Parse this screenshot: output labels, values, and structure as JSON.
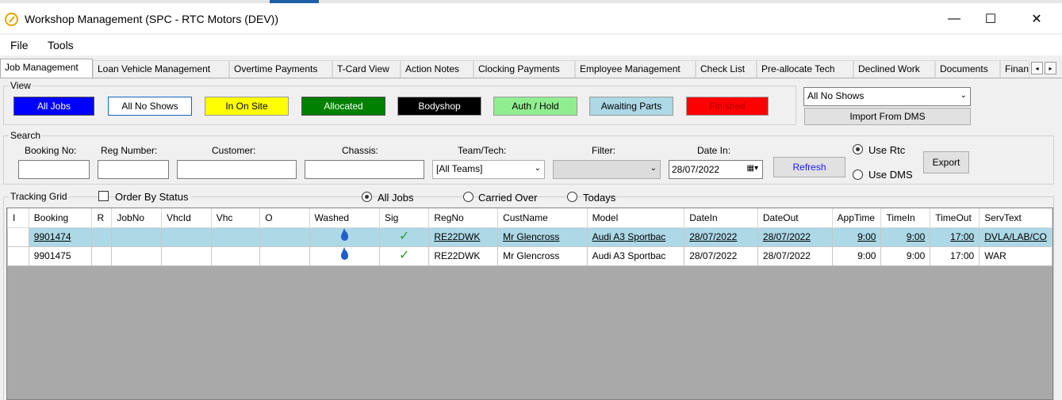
{
  "window": {
    "title": "Workshop Management  (SPC - RTC Motors (DEV))",
    "minimize": "—",
    "maximize": "☐",
    "close": "✕"
  },
  "menu": [
    "File",
    "Tools"
  ],
  "tabs": [
    "Job Management",
    "Loan Vehicle Management",
    "Overtime Payments",
    "T-Card View",
    "Action Notes",
    "Clocking Payments",
    "Employee Management",
    "Check List",
    "Pre-allocate Tech",
    "Declined Work",
    "Documents",
    "Finan"
  ],
  "tab_scroll": {
    "left": "◂",
    "right": "▸"
  },
  "view": {
    "legend": "View",
    "buttons": [
      {
        "label": "All Jobs",
        "bg": "#0000ff",
        "fg": "#ffffff"
      },
      {
        "label": "All No Shows",
        "bg": "#ffffff",
        "fg": "#000000"
      },
      {
        "label": "In On Site",
        "bg": "#ffff00",
        "fg": "#000000"
      },
      {
        "label": "Allocated",
        "bg": "#008000",
        "fg": "#ffffff"
      },
      {
        "label": "Bodyshop",
        "bg": "#000000",
        "fg": "#ffffff"
      },
      {
        "label": "Auth / Hold",
        "bg": "#90ee90",
        "fg": "#000000"
      },
      {
        "label": "Awaiting Parts",
        "bg": "#add8e6",
        "fg": "#000000"
      },
      {
        "label": "Finished",
        "bg": "#ff0000",
        "fg": "#b00000"
      }
    ],
    "dropdown_value": "All No Shows",
    "import_label": "Import From DMS"
  },
  "search": {
    "legend": "Search",
    "booking_label": "Booking No:",
    "reg_label": "Reg Number:",
    "customer_label": "Customer:",
    "chassis_label": "Chassis:",
    "team_label": "Team/Tech:",
    "team_value": "[All Teams]",
    "filter_label": "Filter:",
    "date_label": "Date In:",
    "date_value": "28/07/2022",
    "refresh_label": "Refresh",
    "use_rtc": "Use Rtc",
    "use_dms": "Use DMS",
    "export_label": "Export"
  },
  "tracking": {
    "legend": "Tracking Grid",
    "order_by_status": "Order By Status",
    "radio_all": "All Jobs",
    "radio_carried": "Carried Over",
    "radio_todays": "Todays"
  },
  "grid": {
    "columns": [
      "I",
      "Booking",
      "R",
      "JobNo",
      "VhcId",
      "Vhc",
      "O",
      "Washed",
      "Sig",
      "RegNo",
      "CustName",
      "Model",
      "DateIn",
      "DateOut",
      "AppTime",
      "TimeIn",
      "TimeOut",
      "ServText"
    ],
    "rows": [
      {
        "booking": "9901474",
        "regno": "RE22DWK",
        "custname": "Mr Glencross",
        "model": "Audi A3 Sportbac",
        "datein": "28/07/2022",
        "dateout": "28/07/2022",
        "apptime": "9:00",
        "timein": "9:00",
        "timeout": "17:00",
        "servtext": "DVLA/LAB/CO"
      },
      {
        "booking": "9901475",
        "regno": "RE22DWK",
        "custname": "Mr Glencross",
        "model": "Audi A3 Sportbac",
        "datein": "28/07/2022",
        "dateout": "28/07/2022",
        "apptime": "9:00",
        "timein": "9:00",
        "timeout": "17:00",
        "servtext": "WAR"
      }
    ],
    "washed_icon": "water-drop-icon",
    "sig_icon": "check-icon",
    "tick": "✓"
  }
}
